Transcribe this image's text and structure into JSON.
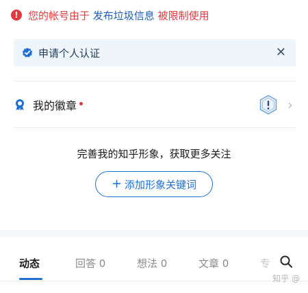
{
  "alert": {
    "text_before": "您的帐号由于",
    "link": "发布垃圾信息",
    "text_after": "被限制使用",
    "icon": "exclamation-circle-icon",
    "color": "#e0393e",
    "link_color": "#1f5fb8"
  },
  "verify": {
    "label": "申请个人认证",
    "close": "✕",
    "icon": "verified-shield-icon"
  },
  "badges": {
    "label": "我的徽章",
    "icon": "medal-icon",
    "chevron": "›"
  },
  "promo": {
    "text": "完善我的知乎形象，获取更多关注",
    "button_plus": "+",
    "button_label": "添加形象关键词"
  },
  "tabs": [
    {
      "label": "动态",
      "active": true
    },
    {
      "label": "回答 0",
      "active": false
    },
    {
      "label": "想法 0",
      "active": false
    },
    {
      "label": "文章 0",
      "active": false
    },
    {
      "label": "专",
      "active": false
    }
  ],
  "watermark": "知乎 @",
  "accent_color": "#1f6fd1"
}
